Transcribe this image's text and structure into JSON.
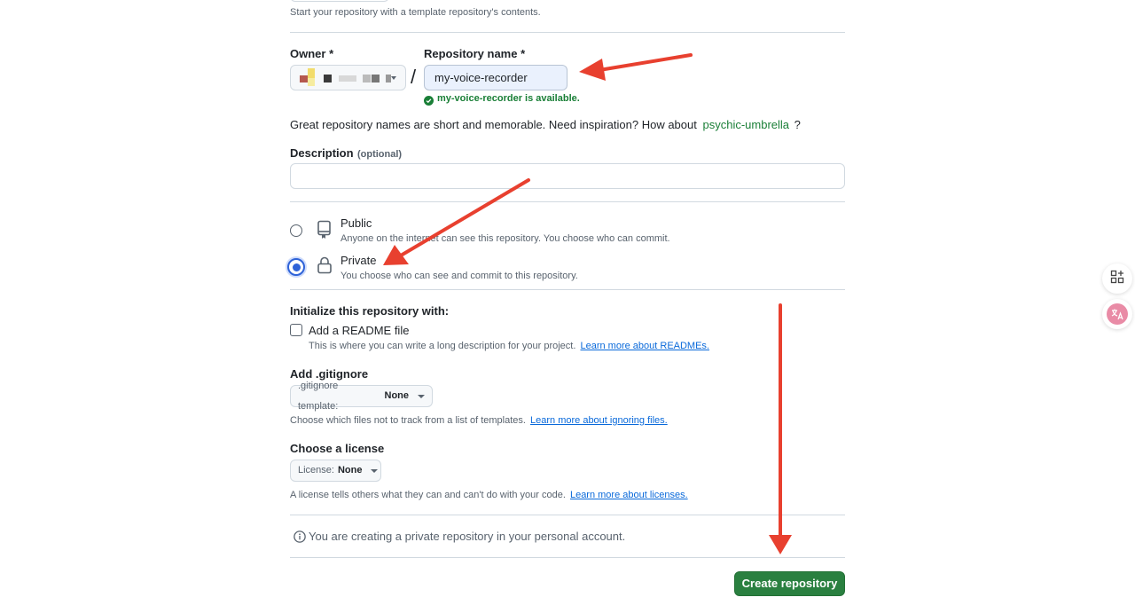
{
  "template": {
    "hint": "Start your repository with a template repository's contents."
  },
  "owner": {
    "label": "Owner *"
  },
  "repo": {
    "label": "Repository name *",
    "value": "my-voice-recorder",
    "available": "my-voice-recorder is available."
  },
  "slash": "/",
  "inspiration": {
    "text": "Great repository names are short and memorable. Need inspiration? How about",
    "suggestion": "psychic-umbrella",
    "end": "?"
  },
  "description": {
    "label": "Description",
    "optional": "(optional)"
  },
  "visibility": {
    "public": {
      "label": "Public",
      "desc": "Anyone on the internet can see this repository. You choose who can commit."
    },
    "private": {
      "label": "Private",
      "desc": "You choose who can see and commit to this repository."
    }
  },
  "init": {
    "heading": "Initialize this repository with:",
    "readme_label": "Add a README file",
    "readme_desc": "This is where you can write a long description for your project.",
    "readme_link": "Learn more about READMEs."
  },
  "gitignore": {
    "heading": "Add .gitignore",
    "dropdown_prefix": ".gitignore template:",
    "dropdown_value": "None",
    "desc": "Choose which files not to track from a list of templates.",
    "link": "Learn more about ignoring files."
  },
  "license": {
    "heading": "Choose a license",
    "dropdown_prefix": "License:",
    "dropdown_value": "None",
    "desc": "A license tells others what they can and can't do with your code.",
    "link": "Learn more about licenses."
  },
  "notice": "You are creating a private repository in your personal account.",
  "create_button": "Create repository",
  "colors": {
    "success": "#1a7f37",
    "create_button": "#2a8040",
    "link": "#0969da",
    "annotation_arrow": "#e8402f"
  },
  "icons": [
    "repo-icon",
    "lock-icon",
    "info-icon",
    "check-circle-icon",
    "apps-icon",
    "translate-icon"
  ]
}
